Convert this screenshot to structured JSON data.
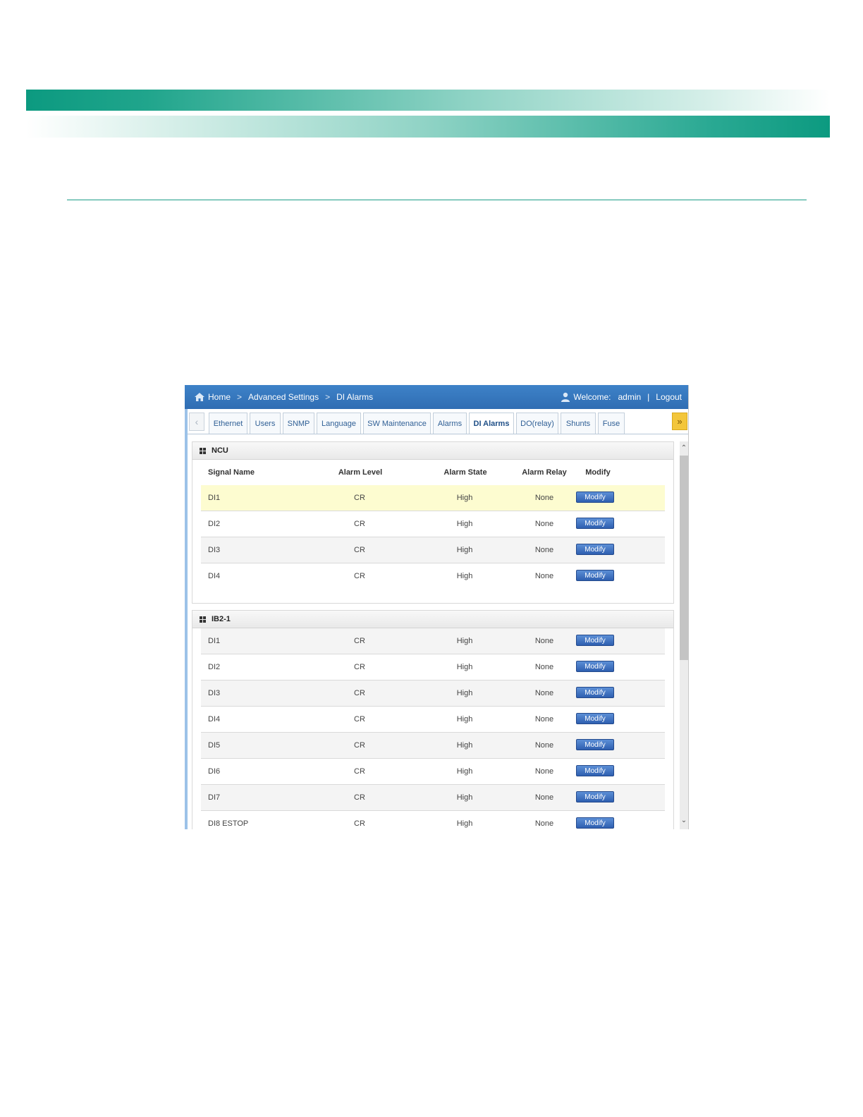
{
  "breadcrumb": {
    "home": "Home",
    "level1": "Advanced Settings",
    "level2": "DI Alarms"
  },
  "user": {
    "welcome_label": "Welcome:",
    "username": "admin",
    "separator": "|",
    "logout": "Logout"
  },
  "tabs": [
    {
      "label": "Ethernet"
    },
    {
      "label": "Users"
    },
    {
      "label": "SNMP"
    },
    {
      "label": "Language"
    },
    {
      "label": "SW Maintenance"
    },
    {
      "label": "Alarms"
    },
    {
      "label": "DI Alarms",
      "active": true
    },
    {
      "label": "DO(relay)"
    },
    {
      "label": "Shunts"
    },
    {
      "label": "Fuse"
    }
  ],
  "columns": {
    "signal_name": "Signal Name",
    "alarm_level": "Alarm Level",
    "alarm_state": "Alarm State",
    "alarm_relay": "Alarm Relay",
    "modify": "Modify"
  },
  "panels": [
    {
      "title": "NCU",
      "rows": [
        {
          "name": "DI1",
          "level": "CR",
          "state": "High",
          "relay": "None",
          "button": "Modify"
        },
        {
          "name": "DI2",
          "level": "CR",
          "state": "High",
          "relay": "None",
          "button": "Modify"
        },
        {
          "name": "DI3",
          "level": "CR",
          "state": "High",
          "relay": "None",
          "button": "Modify"
        },
        {
          "name": "DI4",
          "level": "CR",
          "state": "High",
          "relay": "None",
          "button": "Modify"
        }
      ]
    },
    {
      "title": "IB2-1",
      "rows": [
        {
          "name": "DI1",
          "level": "CR",
          "state": "High",
          "relay": "None",
          "button": "Modify"
        },
        {
          "name": "DI2",
          "level": "CR",
          "state": "High",
          "relay": "None",
          "button": "Modify"
        },
        {
          "name": "DI3",
          "level": "CR",
          "state": "High",
          "relay": "None",
          "button": "Modify"
        },
        {
          "name": "DI4",
          "level": "CR",
          "state": "High",
          "relay": "None",
          "button": "Modify"
        },
        {
          "name": "DI5",
          "level": "CR",
          "state": "High",
          "relay": "None",
          "button": "Modify"
        },
        {
          "name": "DI6",
          "level": "CR",
          "state": "High",
          "relay": "None",
          "button": "Modify"
        },
        {
          "name": "DI7",
          "level": "CR",
          "state": "High",
          "relay": "None",
          "button": "Modify"
        },
        {
          "name": "DI8 ESTOP",
          "level": "CR",
          "state": "High",
          "relay": "None",
          "button": "Modify"
        }
      ]
    }
  ],
  "icons": {
    "home": "home-icon",
    "user": "user-icon",
    "grid": "grid-icon",
    "tabs_prev": "chevron-left-icon",
    "tabs_next": "double-chevron-right-icon",
    "scroll_up": "chevron-up-icon",
    "scroll_down": "chevron-down-icon"
  },
  "colors": {
    "header_blue": "#2f6db3",
    "button_blue": "#2e5fb0",
    "highlight_row": "#fdfcd0",
    "accent_teal": "#0c9a80",
    "next_arrow_yellow": "#f3c63b"
  }
}
